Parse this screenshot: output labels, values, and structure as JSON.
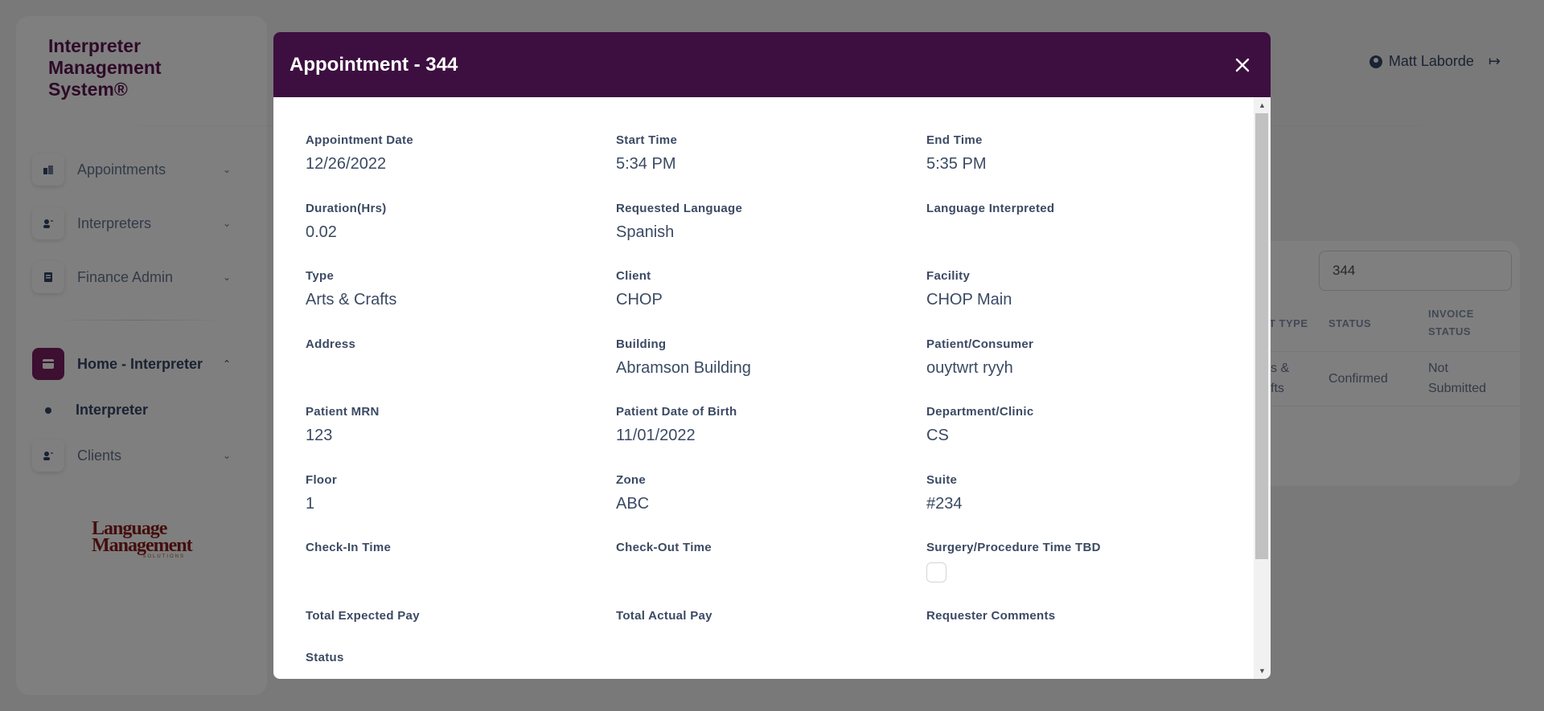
{
  "sidebar": {
    "brand": "Interpreter Management System®",
    "items": [
      {
        "label": "Appointments",
        "icon": "building-icon"
      },
      {
        "label": "Interpreters",
        "icon": "user-card-icon"
      },
      {
        "label": "Finance Admin",
        "icon": "document-icon"
      },
      {
        "label": "Home - Interpreter",
        "icon": "card-icon"
      },
      {
        "label": "Clients",
        "icon": "user-card-icon"
      }
    ],
    "sub_item": "Interpreter",
    "logo": {
      "line1": "Language",
      "line2": "Management",
      "line3": "SOLUTIONS"
    }
  },
  "header": {
    "user_name": "Matt Laborde"
  },
  "background_table": {
    "search_value": "344",
    "headers": [
      "T TYPE",
      "STATUS",
      "INVOICE STATUS"
    ],
    "row": {
      "type": "s & fts",
      "status": "Confirmed",
      "invoice_status": "Not Submitted"
    }
  },
  "modal": {
    "title": "Appointment - 344",
    "fields": [
      {
        "label": "Appointment Date",
        "value": "12/26/2022"
      },
      {
        "label": "Start Time",
        "value": "5:34 PM"
      },
      {
        "label": "End Time",
        "value": "5:35 PM"
      },
      {
        "label": "Duration(Hrs)",
        "value": "0.02"
      },
      {
        "label": "Requested Language",
        "value": "Spanish"
      },
      {
        "label": "Language Interpreted",
        "value": ""
      },
      {
        "label": "Type",
        "value": "Arts & Crafts"
      },
      {
        "label": "Client",
        "value": "CHOP"
      },
      {
        "label": "Facility",
        "value": "CHOP Main"
      },
      {
        "label": "Address",
        "value": ""
      },
      {
        "label": "Building",
        "value": "Abramson Building"
      },
      {
        "label": "Patient/Consumer",
        "value": "ouytwrt ryyh"
      },
      {
        "label": "Patient MRN",
        "value": "123"
      },
      {
        "label": "Patient Date of Birth",
        "value": "11/01/2022"
      },
      {
        "label": "Department/Clinic",
        "value": "CS"
      },
      {
        "label": "Floor",
        "value": "1"
      },
      {
        "label": "Zone",
        "value": "ABC"
      },
      {
        "label": "Suite",
        "value": "#234"
      },
      {
        "label": "Check-In Time",
        "value": ""
      },
      {
        "label": "Check-Out Time",
        "value": ""
      },
      {
        "label": "Surgery/Procedure Time TBD",
        "value": ""
      },
      {
        "label": "Total Expected Pay",
        "value": ""
      },
      {
        "label": "Total Actual Pay",
        "value": ""
      },
      {
        "label": "Requester Comments",
        "value": ""
      },
      {
        "label": "Status",
        "value": ""
      }
    ]
  }
}
